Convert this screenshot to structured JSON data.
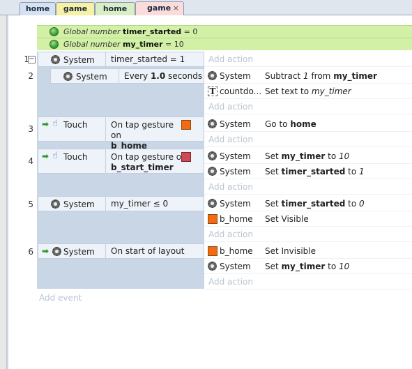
{
  "tabs": [
    {
      "label": "home"
    },
    {
      "label": "game"
    },
    {
      "label": "home"
    },
    {
      "label": "game",
      "close": "×"
    }
  ],
  "globals": [
    {
      "prefix": "Global number",
      "name": "timer_started",
      "value": "= 0"
    },
    {
      "prefix": "Global number",
      "name": "my_timer",
      "value": "= 10"
    }
  ],
  "events": [
    {
      "num": "1",
      "collapse": "−",
      "object": "System",
      "condition": "timer_started = 1",
      "add_action": "Add action"
    },
    {
      "num": "2",
      "object": "System",
      "condition_pre": "Every",
      "condition_bold": "1.0",
      "condition_post": "seconds",
      "actions": [
        {
          "object": "System",
          "pre": "Subtract",
          "italic": "1",
          "mid": "from",
          "bold": "my_timer"
        },
        {
          "object": "countdo...",
          "pre": "Set text to",
          "italic": "my_timer"
        }
      ],
      "add_action": "Add action"
    },
    {
      "num": "3",
      "object": "Touch",
      "condition_pre": "On tap gesture on",
      "condition_bold": "b_home",
      "actions": [
        {
          "object": "System",
          "pre": "Go to",
          "bold": "home"
        }
      ],
      "add_action": "Add action"
    },
    {
      "num": "4",
      "object": "Touch",
      "condition_pre": "On tap gesture on",
      "condition_bold": "b_start_timer",
      "actions": [
        {
          "object": "System",
          "pre": "Set",
          "bold": "my_timer",
          "mid": "to",
          "italic": "10"
        },
        {
          "object": "System",
          "pre": "Set",
          "bold": "timer_started",
          "mid": "to",
          "italic": "1"
        }
      ],
      "add_action": "Add action"
    },
    {
      "num": "5",
      "object": "System",
      "condition": "my_timer ≤ 0",
      "actions": [
        {
          "object": "System",
          "pre": "Set",
          "bold": "timer_started",
          "mid": "to",
          "italic": "0"
        },
        {
          "object": "b_home",
          "pre": "Set Visible"
        }
      ],
      "add_action": "Add action"
    },
    {
      "num": "6",
      "object": "System",
      "condition": "On start of layout",
      "actions": [
        {
          "object": "b_home",
          "pre": "Set Invisible"
        },
        {
          "object": "System",
          "pre": "Set",
          "bold": "my_timer",
          "mid": "to",
          "italic": "10"
        }
      ],
      "add_action": "Add action"
    }
  ],
  "add_event": "Add event",
  "colors": {
    "global_bg": "#d2f0a6",
    "band": "#c8d6e6",
    "sprite_orange": "#f36b10",
    "sprite_red": "#cd4a55"
  }
}
